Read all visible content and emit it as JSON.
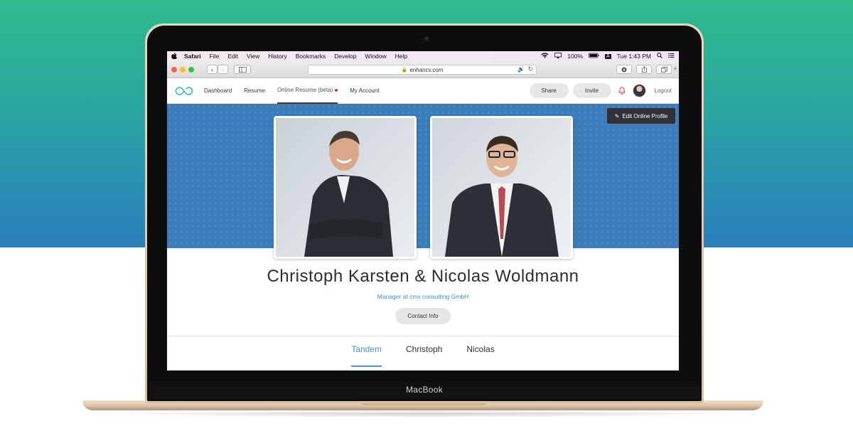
{
  "menubar": {
    "items": [
      "Safari",
      "File",
      "Edit",
      "View",
      "History",
      "Bookmarks",
      "Develop",
      "Window",
      "Help"
    ],
    "battery": "100%",
    "input_source": "A",
    "clock": "Tue 1:43 PM"
  },
  "browser": {
    "url": "enhancv.com"
  },
  "app": {
    "nav": [
      {
        "label": "Dashboard"
      },
      {
        "label": "Resume"
      },
      {
        "label": "Online Resume (beta)"
      },
      {
        "label": "My Account"
      }
    ],
    "share_label": "Share",
    "invite_label": "Invite",
    "logout_label": "Logout",
    "edit_profile_label": "Edit Online Profile"
  },
  "profile": {
    "name": "Christoph Karsten & Nicolas Woldmann",
    "headline": "Manager at cmx consulting GmbH",
    "contact_label": "Contact Info",
    "tabs": [
      {
        "label": "Tandem",
        "active": true
      },
      {
        "label": "Christoph",
        "active": false
      },
      {
        "label": "Nicolas",
        "active": false
      }
    ]
  },
  "device": {
    "label": "MacBook"
  },
  "colors": {
    "accent": "#4a8fdc",
    "banner": "#3b7dbb",
    "logo": "#2fbf9a",
    "notification": "#e0332a"
  }
}
